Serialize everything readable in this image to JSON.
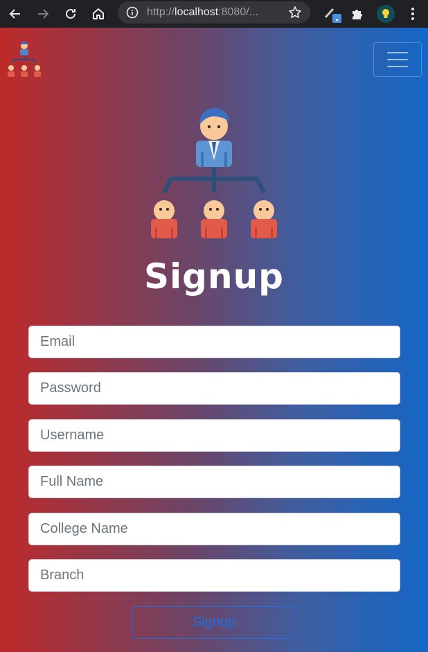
{
  "browser": {
    "url_prefix": "http://",
    "url_host": "localhost",
    "url_rest": ":8080/..."
  },
  "icons": {
    "back": "arrow-left-icon",
    "forward": "arrow-right-icon",
    "reload": "reload-icon",
    "home": "home-icon",
    "info": "info-icon",
    "bookmark": "star-icon",
    "extension_pen": "pen-extension-icon",
    "extensions": "puzzle-icon",
    "profile": "lightbulb-avatar-icon",
    "menu": "kebab-menu-icon",
    "nav_toggle": "hamburger-icon"
  },
  "colors": {
    "gradient_left": "#bd2a2a",
    "gradient_right": "#1466c6",
    "button_accent": "#1f6fe0"
  },
  "page": {
    "title": "Signup"
  },
  "form": {
    "email_placeholder": "Email",
    "password_placeholder": "Password",
    "username_placeholder": "Username",
    "fullname_placeholder": "Full Name",
    "college_placeholder": "College Name",
    "branch_placeholder": "Branch",
    "submit_label": "Signup"
  }
}
